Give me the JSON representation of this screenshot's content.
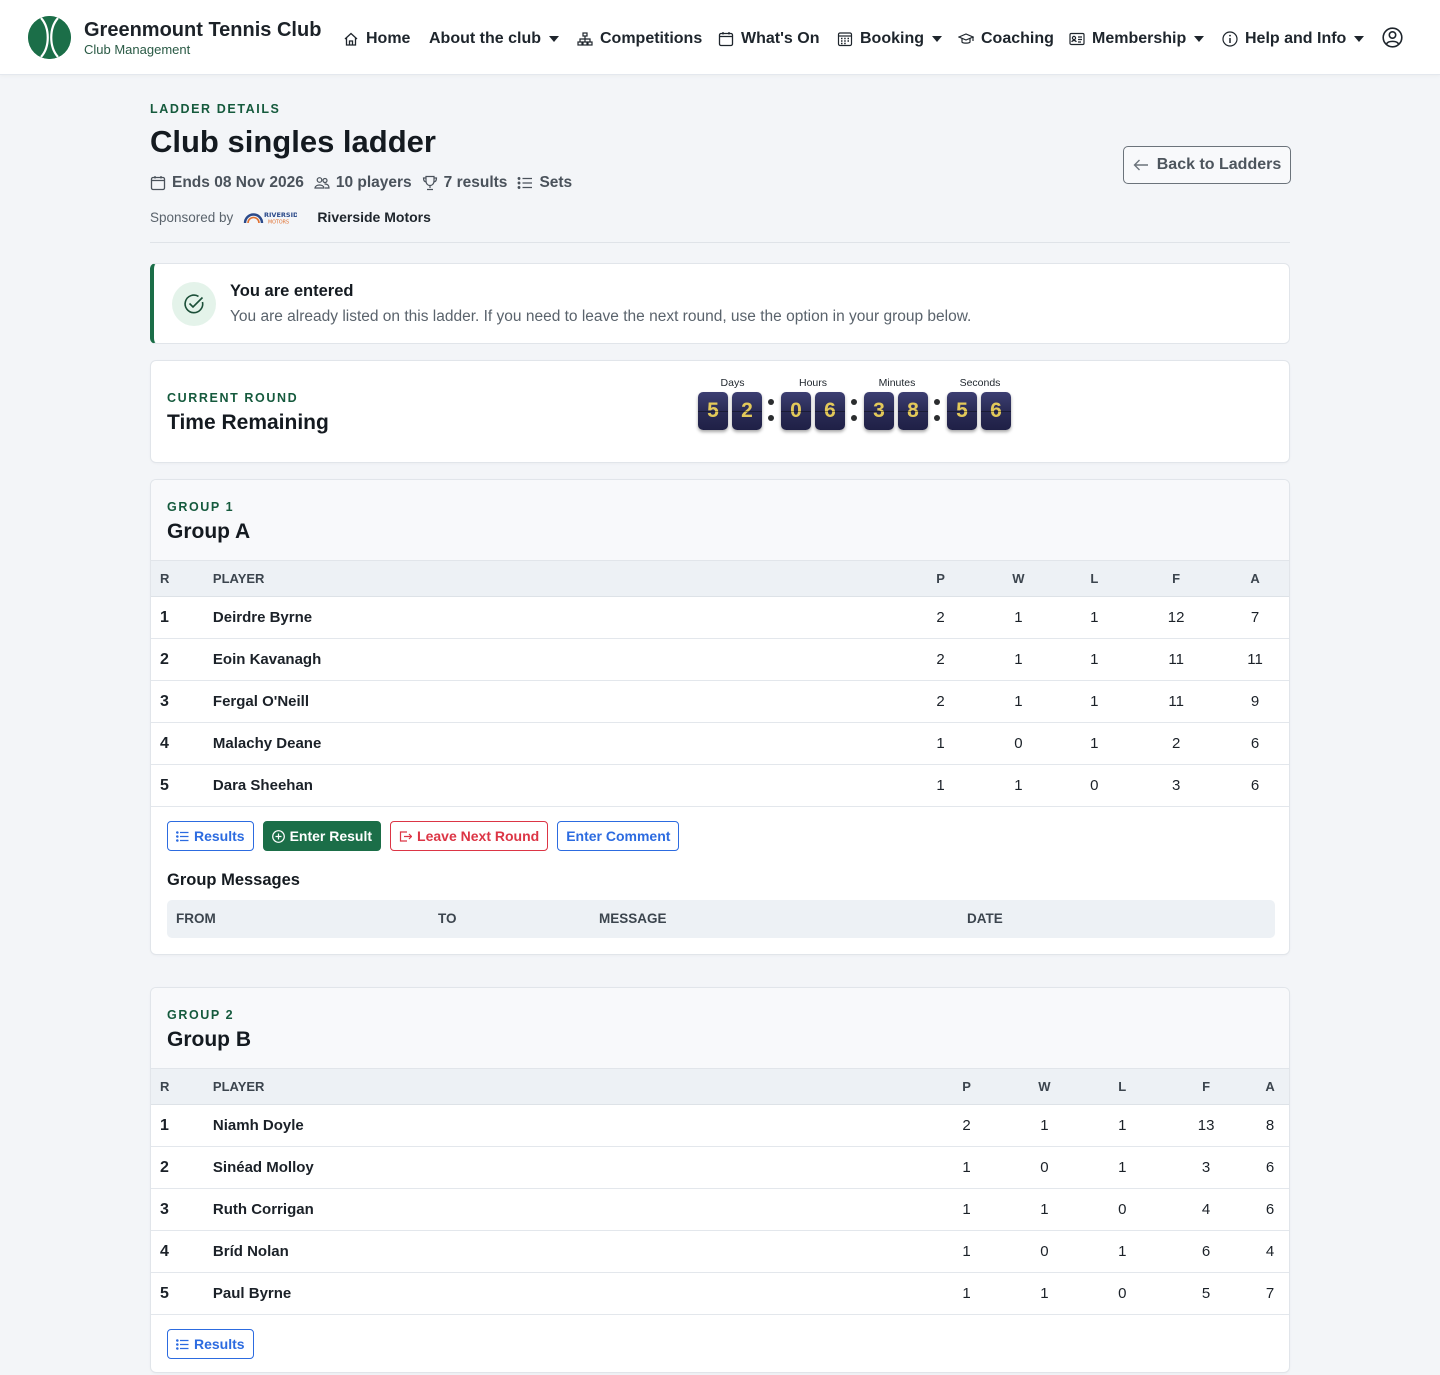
{
  "brand": {
    "name": "Greenmount Tennis Club",
    "subtitle": "Club Management"
  },
  "nav": [
    {
      "label": "Home",
      "icon": "home-icon",
      "dropdown": false
    },
    {
      "label": "About the club",
      "icon": null,
      "dropdown": true
    },
    {
      "label": "Competitions",
      "icon": "diagram-icon",
      "dropdown": false
    },
    {
      "label": "What's On",
      "icon": "calendar-icon",
      "dropdown": false
    },
    {
      "label": "Booking",
      "icon": "calendar-grid-icon",
      "dropdown": true
    },
    {
      "label": "Coaching",
      "icon": "mortarboard-icon",
      "dropdown": false
    },
    {
      "label": "Membership",
      "icon": "id-card-icon",
      "dropdown": true
    },
    {
      "label": "Help and Info",
      "icon": "info-icon",
      "dropdown": true
    }
  ],
  "header": {
    "eyebrow": "LADDER DETAILS",
    "title": "Club singles ladder",
    "ends": "Ends 08 Nov 2026",
    "players": "10 players",
    "results": "7 results",
    "format": "Sets",
    "sponsored_by": "Sponsored by",
    "sponsor_name": "Riverside Motors",
    "sponsor_logo_text": "RIVERSIDE",
    "sponsor_logo_subtext": "MOTORS",
    "back_button": "Back to Ladders"
  },
  "alert": {
    "title": "You are entered",
    "text": "You are already listed on this ladder. If you need to leave the next round, use the option in your group below."
  },
  "round": {
    "eyebrow": "CURRENT ROUND",
    "title": "Time Remaining",
    "labels": {
      "days": "Days",
      "hours": "Hours",
      "minutes": "Minutes",
      "seconds": "Seconds"
    },
    "digits": [
      "5",
      "2",
      "0",
      "6",
      "3",
      "8",
      "5",
      "6"
    ]
  },
  "columns": {
    "r": "R",
    "player": "PLAYER",
    "p": "P",
    "w": "W",
    "l": "L",
    "f": "F",
    "a": "A"
  },
  "groups": [
    {
      "eyebrow": "GROUP 1",
      "title": "Group A",
      "rows": [
        {
          "r": "1",
          "player": "Deirdre Byrne",
          "p": "2",
          "w": "1",
          "l": "1",
          "f": "12",
          "a": "7"
        },
        {
          "r": "2",
          "player": "Eoin Kavanagh",
          "p": "2",
          "w": "1",
          "l": "1",
          "f": "11",
          "a": "11"
        },
        {
          "r": "3",
          "player": "Fergal O'Neill",
          "p": "2",
          "w": "1",
          "l": "1",
          "f": "11",
          "a": "9"
        },
        {
          "r": "4",
          "player": "Malachy Deane",
          "p": "1",
          "w": "0",
          "l": "1",
          "f": "2",
          "a": "6"
        },
        {
          "r": "5",
          "player": "Dara Sheehan",
          "p": "1",
          "w": "1",
          "l": "0",
          "f": "3",
          "a": "6"
        }
      ],
      "buttons": {
        "results": "Results",
        "enter_result": "Enter Result",
        "leave_next_round": "Leave Next Round",
        "enter_comment": "Enter Comment"
      },
      "messages": {
        "title": "Group Messages",
        "from": "FROM",
        "to": "TO",
        "message": "MESSAGE",
        "date": "DATE"
      }
    },
    {
      "eyebrow": "GROUP 2",
      "title": "Group B",
      "rows": [
        {
          "r": "1",
          "player": "Niamh Doyle",
          "p": "2",
          "w": "1",
          "l": "1",
          "f": "13",
          "a": "8"
        },
        {
          "r": "2",
          "player": "Sinéad Molloy",
          "p": "1",
          "w": "0",
          "l": "1",
          "f": "3",
          "a": "6"
        },
        {
          "r": "3",
          "player": "Ruth Corrigan",
          "p": "1",
          "w": "1",
          "l": "0",
          "f": "4",
          "a": "6"
        },
        {
          "r": "4",
          "player": "Bríd Nolan",
          "p": "1",
          "w": "0",
          "l": "1",
          "f": "6",
          "a": "4"
        },
        {
          "r": "5",
          "player": "Paul Byrne",
          "p": "1",
          "w": "1",
          "l": "0",
          "f": "5",
          "a": "7"
        }
      ],
      "buttons": {
        "results": "Results"
      }
    }
  ],
  "colors": {
    "brand_green": "#1b6e48",
    "link_blue": "#2c6be0",
    "danger_red": "#dc3545",
    "countdown_bg": "#2a2b55",
    "countdown_digit": "#e3c95a"
  }
}
